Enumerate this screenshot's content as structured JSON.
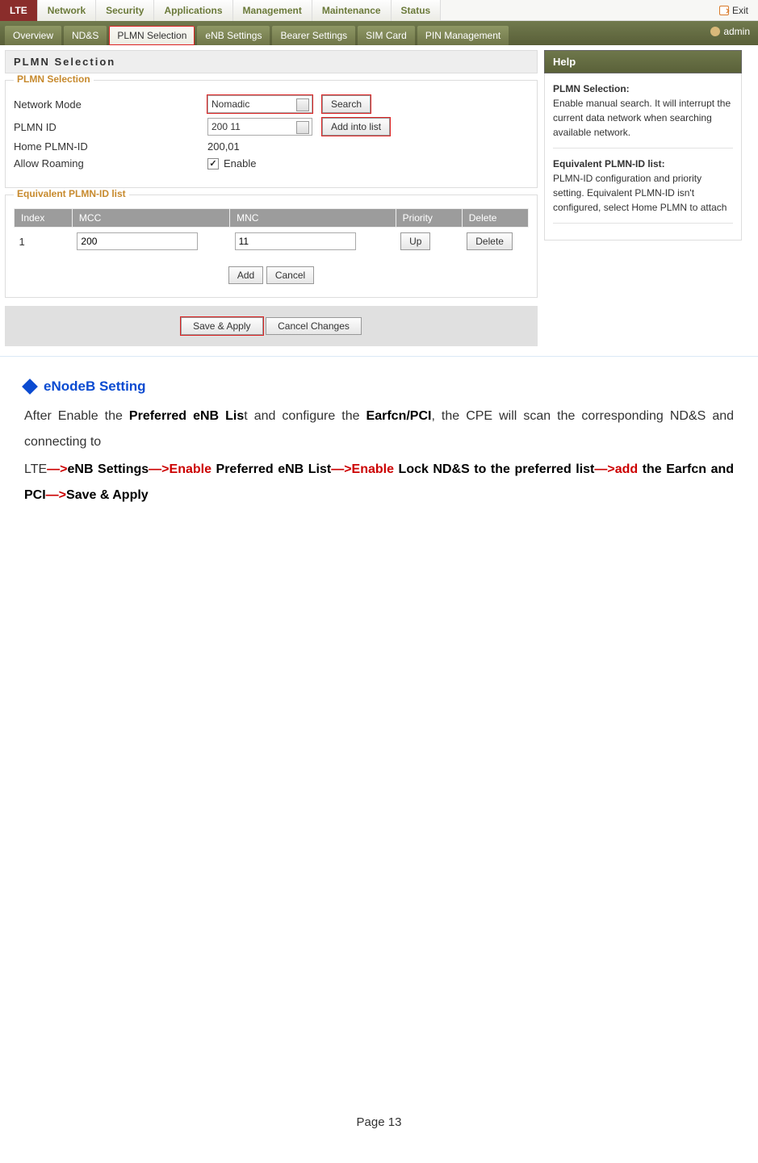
{
  "topnav": {
    "tabs": [
      "LTE",
      "Network",
      "Security",
      "Applications",
      "Management",
      "Maintenance",
      "Status"
    ],
    "exit": "Exit"
  },
  "subnav": {
    "tabs": [
      "Overview",
      "ND&S",
      "PLMN Selection",
      "eNB Settings",
      "Bearer Settings",
      "SIM Card",
      "PIN Management"
    ],
    "user": "admin"
  },
  "panel": {
    "title": "PLMN  Selection",
    "fieldset1": {
      "legend": "PLMN Selection",
      "rows": {
        "networkMode": {
          "label": "Network Mode",
          "value": "Nomadic",
          "button": "Search"
        },
        "plmnId": {
          "label": "PLMN ID",
          "value": "200 11",
          "button": "Add into list"
        },
        "homePlmn": {
          "label": "Home PLMN-ID",
          "value": "200,01"
        },
        "roaming": {
          "label": "Allow Roaming",
          "cblabel": "Enable"
        }
      }
    },
    "fieldset2": {
      "legend": "Equivalent PLMN-ID list",
      "headers": [
        "Index",
        "MCC",
        "MNC",
        "Priority",
        "Delete"
      ],
      "row": {
        "index": "1",
        "mcc": "200",
        "mnc": "11",
        "up": "Up",
        "del": "Delete"
      },
      "add": "Add",
      "cancel": "Cancel"
    },
    "actions": {
      "save": "Save & Apply",
      "cancel": "Cancel Changes"
    }
  },
  "help": {
    "title": "Help",
    "h1": "PLMN Selection:",
    "p1": "Enable manual search. It will interrupt the current data network when searching available network.",
    "h2": "Equivalent PLMN-ID list:",
    "p2": "PLMN-ID configuration and priority setting. Equivalent PLMN-ID isn't configured, select Home PLMN to attach"
  },
  "doc": {
    "heading": "eNodeB Setting",
    "p1a": "After  Enable  the  ",
    "p1b": "Preferred  eNB  Lis",
    "p1c": "t  and  configure  the  ",
    "p1d": "Earfcn/PCI",
    "p1e": ",  the  CPE  will  scan  the corresponding ND&S and connecting to",
    "l1": "LTE",
    "a1": "—>",
    "l2": "eNB  Settings",
    "a2": "—>",
    "l3": "Enable",
    "l4": "  Preferred  eNB  List",
    "a3": "—>",
    "l5": "Enable",
    "l6": "  Lock  ND&S  to  the  preferred list",
    "a4": "—>",
    "l7": "add",
    "l8": " the Earfcn and PCI",
    "a5": "—>",
    "l9": "Save & Apply"
  },
  "footer": "Page 13"
}
